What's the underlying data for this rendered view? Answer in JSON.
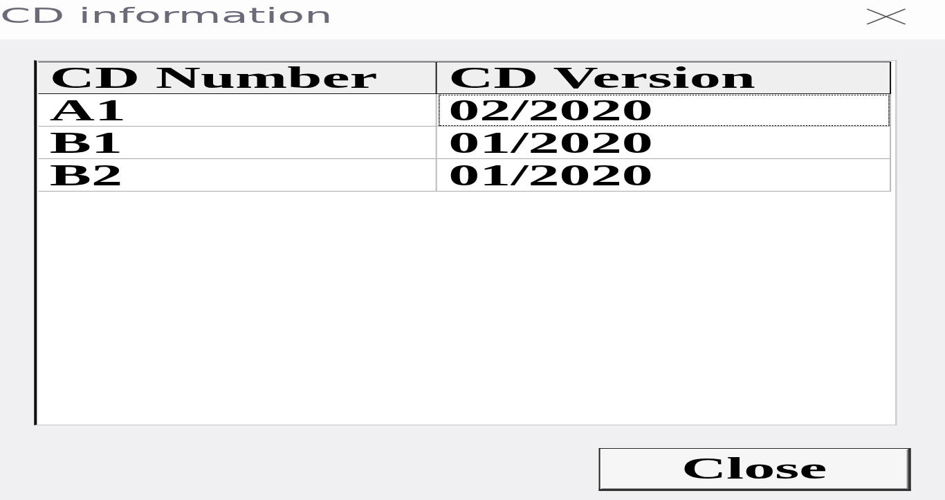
{
  "window": {
    "title": "CD information"
  },
  "table": {
    "columns": [
      "CD Number",
      "CD Version"
    ],
    "rows": [
      {
        "cells": [
          {
            "text": "A1",
            "focused": false
          },
          {
            "text": "02/2020",
            "focused": true
          }
        ]
      },
      {
        "cells": [
          {
            "text": "B1",
            "focused": false
          },
          {
            "text": "01/2020",
            "focused": false
          }
        ]
      },
      {
        "cells": [
          {
            "text": "B2",
            "focused": false
          },
          {
            "text": "01/2020",
            "focused": false
          }
        ]
      }
    ]
  },
  "buttons": [
    "Close"
  ]
}
